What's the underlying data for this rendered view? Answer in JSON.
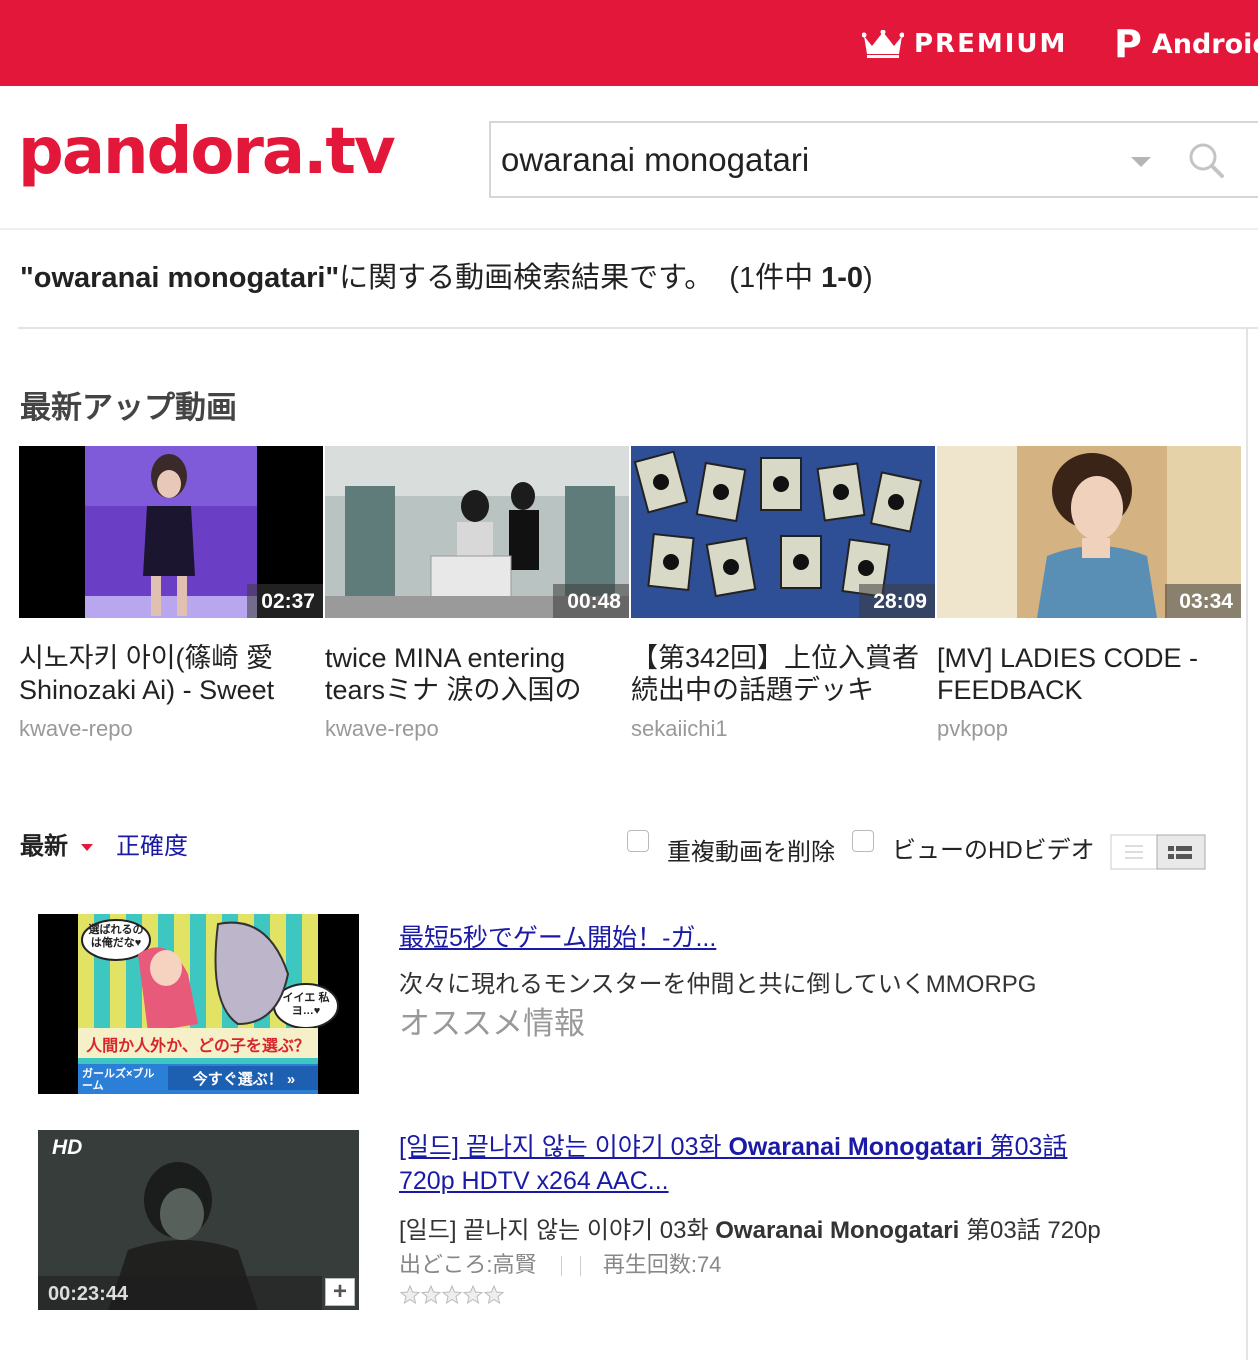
{
  "header": {
    "premium_label": "PREMIUM",
    "android_label": "Android",
    "brand_color": "#e2173a"
  },
  "logo": {
    "text": "pandora.tv"
  },
  "search": {
    "query": "owaranai monogatari"
  },
  "results_summary": {
    "query_quoted": "\"owaranai monogatari\"",
    "suffix": "に関する動画検索結果です。",
    "count_open": "(1件中 ",
    "count_range": "1-0",
    "count_close": ")"
  },
  "latest": {
    "title": "最新アップ動画",
    "videos": [
      {
        "duration": "02:37",
        "title": "시노자키 아이(篠崎 愛 Shinozaki Ai) - Sweet",
        "uploader": "kwave-repo"
      },
      {
        "duration": "00:48",
        "title": "twice MINA entering tearsミナ 涙の入国の",
        "uploader": "kwave-repo"
      },
      {
        "duration": "28:09",
        "title": "【第342回】上位入賞者続出中の話題デッキ",
        "uploader": "sekaiichi1"
      },
      {
        "duration": "03:34",
        "title": "[MV] LADIES CODE - FEEDBACK",
        "uploader": "pvkpop"
      }
    ]
  },
  "sort": {
    "latest_label": "最新",
    "accuracy_label": "正確度",
    "remove_duplicates_label": "重複動画を削除",
    "hd_only_label": "ビューのHDビデオ"
  },
  "ad": {
    "title": "最短5秒でゲーム開始！-ガ...",
    "description": "次々に現れるモンスターを仲間と共に倒していくMMORPG",
    "tag": "オススメ情報",
    "banner_top": "選ばれるのは俺だな♥",
    "banner_bubble": "イイエ 私ヨ…♥",
    "banner_main": "人間か人外か、どの子を選ぶ？",
    "banner_cta": "今すぐ選ぶ！ »",
    "banner_logo": "ガールズ×ブルーム"
  },
  "result": {
    "hd_badge": "HD",
    "duration": "00:23:44",
    "title_line1_pre": "[일드] 끝나지 않는 이야기 03화 ",
    "title_line1_bold": "Owaranai Monogatari",
    "title_line1_post": " 第03話",
    "title_line2": "720p HDTV x264 AAC...",
    "desc_pre": "[일드] 끝나지 않는 이야기 03화 ",
    "desc_bold": "Owaranai Monogatari",
    "desc_post": " 第03話 720p",
    "source": "出どころ:高賢",
    "plays": "再生回数:74",
    "rating_stars": 0
  }
}
